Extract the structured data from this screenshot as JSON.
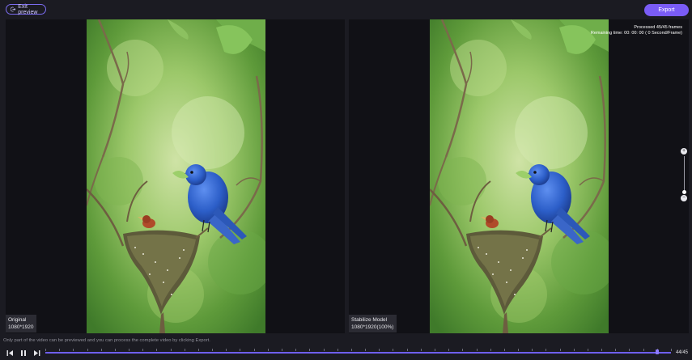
{
  "toolbar": {
    "exit_label": "Exit preview",
    "export_label": "Export"
  },
  "left_panel": {
    "title": "Original",
    "resolution": "1080*1920"
  },
  "right_panel": {
    "title": "Stabilize Model",
    "resolution": "1080*1920(100%)",
    "processed": "Processed 45/45 frames",
    "remaining": "Remaining time: 00: 00: 00 ( 0 Second/Frame)"
  },
  "notice": "Only part of the video can be previewed and you can process the complete video by clicking Export.",
  "player": {
    "counter": "44/45",
    "current_frame": 44,
    "total_frames": 45
  },
  "colors": {
    "accent": "#7a5cf6",
    "background": "#1b1b22",
    "panel": "#111116"
  },
  "icons": {
    "exit": "exit-icon",
    "zoom_in": "zoom-in-icon",
    "zoom_out": "zoom-out-icon",
    "prev": "previous-frame-icon",
    "pause": "pause-icon",
    "next": "next-frame-icon"
  }
}
